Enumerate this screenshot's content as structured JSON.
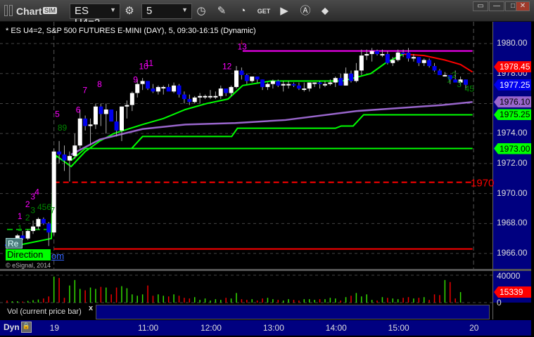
{
  "window": {
    "title": "Chart",
    "sim_badge": "SIM",
    "symbol": "ES U4=2",
    "interval": "5",
    "window_buttons": [
      "restore",
      "minimize",
      "maximize",
      "close"
    ],
    "toolbar_icons": [
      "settings-gear-icon",
      "clock-icon",
      "pencil-icon",
      "study-icon",
      "get-icon",
      "play-icon",
      "alert-icon",
      "link-icon"
    ]
  },
  "header": "* ES U4=2, S&P 500 FUTURES E-MINI (DAY), 5, 09:30-16:15 (Dynamic)",
  "overlay": {
    "direction_label": "Direction",
    "re_label": "Re",
    "om_label": "om",
    "copyright": "© eSignal, 2014"
  },
  "volume_panel": {
    "label": "Vol (current price bar)",
    "close": "x",
    "ticks": [
      "40000",
      "0"
    ],
    "current": "15339"
  },
  "footer": {
    "dyn": "Dyn"
  },
  "colors": {
    "up": "#ffffff",
    "down": "#0000ee",
    "ma": "#00ff00",
    "ma_down": "#ff0000",
    "vwap": "#9966cc",
    "target": "#ff00ff",
    "support": "#ff0000",
    "axis_bg": "#000080"
  },
  "chart_data": {
    "type": "candlestick",
    "title": "* ES U4=2, S&P 500 FUTURES E-MINI (DAY), 5, 09:30-16:15 (Dynamic)",
    "ylim": [
      1965.2,
      1980.8
    ],
    "y_ticks": [
      "1980.00",
      "1978.00",
      "1976.00",
      "1974.00",
      "1972.00",
      "1970.00",
      "1968.00",
      "1966.00"
    ],
    "x_ticks": [
      {
        "label": "19",
        "bar": 9
      },
      {
        "label": "11:00",
        "bar": 27
      },
      {
        "label": "12:00",
        "bar": 39
      },
      {
        "label": "13:00",
        "bar": 51
      },
      {
        "label": "14:00",
        "bar": 63
      },
      {
        "label": "15:00",
        "bar": 75
      },
      {
        "label": "20",
        "bar": 89.5
      }
    ],
    "price_tags": [
      {
        "label": "1978.45",
        "value": 1978.45,
        "color": "#ff0000",
        "text": "#ffffff"
      },
      {
        "label": "1977.25",
        "value": 1977.25,
        "color": "#0000ee",
        "text": "#ffffff"
      },
      {
        "label": "1976.10",
        "value": 1976.1,
        "color": "#9966cc",
        "text": "#000000"
      },
      {
        "label": "1975.25",
        "value": 1975.25,
        "color": "#00ff00",
        "text": "#000000"
      },
      {
        "label": "1973.00",
        "value": 1973.0,
        "color": "#00ff00",
        "text": "#000000"
      }
    ],
    "bars": [
      [
        1966.6,
        1966.8,
        1966.3,
        1966.5
      ],
      [
        1966.5,
        1967.0,
        1966.4,
        1966.9
      ],
      [
        1966.9,
        1967.3,
        1966.8,
        1967.2
      ],
      [
        1967.2,
        1967.5,
        1966.9,
        1967.0
      ],
      [
        1967.0,
        1967.6,
        1966.9,
        1967.5
      ],
      [
        1967.5,
        1968.2,
        1967.3,
        1967.8
      ],
      [
        1967.8,
        1968.4,
        1967.6,
        1968.3
      ],
      [
        1968.3,
        1968.4,
        1967.9,
        1968.0
      ],
      [
        1968.0,
        1968.1,
        1966.5,
        1967.4
      ],
      [
        1967.4,
        1973.0,
        1967.2,
        1972.8
      ],
      [
        1972.8,
        1973.5,
        1972.0,
        1972.6
      ],
      [
        1972.6,
        1973.2,
        1971.5,
        1972.2
      ],
      [
        1972.2,
        1972.8,
        1970.8,
        1972.5
      ],
      [
        1972.5,
        1974.0,
        1972.3,
        1973.2
      ],
      [
        1973.2,
        1975.6,
        1973.0,
        1975.0
      ],
      [
        1975.0,
        1975.2,
        1974.2,
        1974.5
      ],
      [
        1974.5,
        1975.0,
        1973.2,
        1974.6
      ],
      [
        1974.6,
        1976.0,
        1974.3,
        1975.8
      ],
      [
        1975.8,
        1976.0,
        1974.5,
        1975.3
      ],
      [
        1975.3,
        1976.0,
        1974.0,
        1975.6
      ],
      [
        1975.6,
        1975.6,
        1974.8,
        1974.8
      ],
      [
        1974.8,
        1975.5,
        1973.8,
        1974.2
      ],
      [
        1974.2,
        1975.8,
        1973.5,
        1975.8
      ],
      [
        1975.8,
        1976.2,
        1975.0,
        1975.9
      ],
      [
        1975.9,
        1976.8,
        1975.5,
        1976.7
      ],
      [
        1976.7,
        1977.6,
        1976.4,
        1977.3
      ],
      [
        1977.3,
        1977.7,
        1976.9,
        1977.5
      ],
      [
        1977.5,
        1977.5,
        1976.9,
        1977.0
      ],
      [
        1977.0,
        1977.3,
        1976.7,
        1976.8
      ],
      [
        1976.8,
        1977.2,
        1976.6,
        1977.1
      ],
      [
        1977.1,
        1977.2,
        1976.6,
        1977.1
      ],
      [
        1977.1,
        1977.3,
        1976.9,
        1976.8
      ],
      [
        1976.8,
        1977.4,
        1976.7,
        1977.2
      ],
      [
        1977.2,
        1977.3,
        1976.4,
        1976.6
      ],
      [
        1976.6,
        1976.8,
        1976.0,
        1976.3
      ],
      [
        1976.3,
        1976.6,
        1975.9,
        1976.1
      ],
      [
        1976.1,
        1976.5,
        1976.0,
        1976.4
      ],
      [
        1976.4,
        1976.7,
        1976.0,
        1976.5
      ],
      [
        1976.5,
        1976.6,
        1976.3,
        1976.5
      ],
      [
        1976.5,
        1976.9,
        1976.3,
        1976.5
      ],
      [
        1976.5,
        1976.8,
        1976.3,
        1976.5
      ],
      [
        1976.5,
        1977.2,
        1976.3,
        1977.0
      ],
      [
        1977.0,
        1977.0,
        1976.5,
        1976.7
      ],
      [
        1976.7,
        1977.2,
        1976.5,
        1977.1
      ],
      [
        1977.1,
        1978.5,
        1977.0,
        1978.2
      ],
      [
        1978.2,
        1978.4,
        1977.6,
        1977.9
      ],
      [
        1977.9,
        1978.0,
        1977.3,
        1977.5
      ],
      [
        1977.5,
        1977.8,
        1977.4,
        1977.8
      ],
      [
        1977.8,
        1977.8,
        1977.4,
        1977.6
      ],
      [
        1977.6,
        1977.6,
        1976.9,
        1977.1
      ],
      [
        1977.1,
        1977.4,
        1976.9,
        1977.3
      ],
      [
        1977.3,
        1977.6,
        1977.0,
        1977.5
      ],
      [
        1977.5,
        1977.6,
        1977.1,
        1977.2
      ],
      [
        1977.2,
        1977.5,
        1976.8,
        1977.3
      ],
      [
        1977.3,
        1977.5,
        1977.0,
        1977.3
      ],
      [
        1977.3,
        1977.4,
        1977.1,
        1977.2
      ],
      [
        1977.2,
        1977.4,
        1976.9,
        1977.0
      ],
      [
        1977.0,
        1977.4,
        1976.8,
        1977.0
      ],
      [
        1977.0,
        1977.4,
        1976.8,
        1977.4
      ],
      [
        1977.4,
        1977.4,
        1977.1,
        1977.4
      ],
      [
        1977.4,
        1977.5,
        1977.0,
        1977.3
      ],
      [
        1977.3,
        1977.5,
        1977.1,
        1977.3
      ],
      [
        1977.3,
        1977.6,
        1977.2,
        1977.4
      ],
      [
        1977.4,
        1977.8,
        1977.1,
        1977.7
      ],
      [
        1977.7,
        1978.0,
        1977.2,
        1977.2
      ],
      [
        1977.2,
        1978.4,
        1977.2,
        1978.0
      ],
      [
        1978.0,
        1978.2,
        1977.4,
        1977.5
      ],
      [
        1977.5,
        1978.7,
        1977.4,
        1978.2
      ],
      [
        1978.2,
        1979.6,
        1977.9,
        1979.2
      ],
      [
        1979.2,
        1979.6,
        1978.9,
        1979.3
      ],
      [
        1979.3,
        1979.7,
        1978.8,
        1979.5
      ],
      [
        1979.5,
        1979.6,
        1979.2,
        1979.3
      ],
      [
        1979.3,
        1979.6,
        1979.1,
        1979.3
      ],
      [
        1979.3,
        1979.5,
        1978.6,
        1978.7
      ],
      [
        1978.7,
        1979.1,
        1978.5,
        1978.9
      ],
      [
        1978.9,
        1979.6,
        1978.8,
        1979.4
      ],
      [
        1979.4,
        1979.6,
        1979.1,
        1979.3
      ],
      [
        1979.4,
        1979.7,
        1978.8,
        1979.0
      ],
      [
        1979.0,
        1979.3,
        1978.8,
        1979.1
      ],
      [
        1979.1,
        1979.1,
        1978.5,
        1978.7
      ],
      [
        1978.7,
        1979.0,
        1978.5,
        1978.9
      ],
      [
        1978.9,
        1979.0,
        1978.4,
        1978.5
      ],
      [
        1978.5,
        1978.7,
        1978.1,
        1978.2
      ],
      [
        1978.2,
        1978.3,
        1977.9,
        1977.9
      ],
      [
        1977.9,
        1978.1,
        1977.8,
        1977.9
      ],
      [
        1977.9,
        1977.9,
        1977.3,
        1977.6
      ],
      [
        1977.6,
        1978.2,
        1977.4,
        1977.4
      ],
      [
        1977.4,
        1977.8,
        1977.2,
        1977.6
      ],
      [
        1977.6,
        1977.6,
        1976.9,
        1977.25
      ]
    ],
    "volume": [
      3000,
      2000,
      2000,
      1500,
      2500,
      3500,
      4500,
      6000,
      9000,
      38000,
      36000,
      7000,
      25000,
      33000,
      20000,
      18000,
      22000,
      20000,
      23000,
      22000,
      12000,
      22000,
      24000,
      21000,
      12000,
      10000,
      12000,
      25000,
      10000,
      12000,
      10000,
      9000,
      12000,
      10000,
      7000,
      6000,
      8000,
      4000,
      6000,
      3000,
      5000,
      4000,
      7000,
      6000,
      14000,
      5000,
      4000,
      5000,
      3000,
      6000,
      7000,
      5000,
      4000,
      3000,
      5000,
      4000,
      3000,
      5000,
      5000,
      4000,
      5000,
      5000,
      7000,
      6000,
      3000,
      8000,
      10000,
      14000,
      9000,
      12000,
      4000,
      3000,
      8000,
      7000,
      6000,
      5000,
      7000,
      8000,
      6000,
      7000,
      8000,
      4000,
      12000,
      11000,
      33000,
      30000,
      6000,
      15339
    ],
    "vol_ylim": [
      0,
      40000
    ],
    "lines": [
      {
        "kind": "ma",
        "color": "#00ff00",
        "points": [
          [
            0,
            1966.4
          ],
          [
            8.5,
            1967.0
          ],
          [
            8.9,
            1972.0
          ],
          [
            9.5,
            1972.5
          ],
          [
            12.3,
            1971.8
          ],
          [
            15,
            1972.8
          ],
          [
            17.8,
            1973.5
          ],
          [
            20.5,
            1974.0
          ],
          [
            26,
            1974.6
          ],
          [
            30,
            1975.0
          ],
          [
            34.2,
            1975.6
          ],
          [
            38.3,
            1976.0
          ],
          [
            42.4,
            1976.3
          ],
          [
            45.2,
            1977.2
          ],
          [
            50.6,
            1977.5
          ],
          [
            64.3,
            1977.5
          ],
          [
            69.8,
            1978.0
          ],
          [
            72.6,
            1978.7
          ],
          [
            76,
            1979.3
          ]
        ]
      },
      {
        "kind": "ma-down",
        "color": "#ff0000",
        "points": [
          [
            76,
            1979.3
          ],
          [
            80,
            1979.2
          ],
          [
            84,
            1978.9
          ],
          [
            87,
            1978.6
          ],
          [
            89.3,
            1978.1
          ]
        ]
      },
      {
        "kind": "vwap",
        "color": "#9966cc",
        "points": [
          [
            12.3,
            1972.6
          ],
          [
            17.8,
            1973.6
          ],
          [
            26,
            1974.3
          ],
          [
            34.2,
            1974.6
          ],
          [
            43.8,
            1974.7
          ],
          [
            53.4,
            1974.9
          ],
          [
            67.1,
            1975.5
          ],
          [
            75.3,
            1975.7
          ],
          [
            83.5,
            1975.9
          ],
          [
            89.3,
            1976.1
          ]
        ]
      },
      {
        "kind": "step",
        "color": "#00ff00",
        "points": [
          [
            12.3,
            1972.2
          ],
          [
            15,
            1973.0
          ],
          [
            23.9,
            1973.0
          ],
          [
            26,
            1973.8
          ],
          [
            43.1,
            1973.8
          ],
          [
            44.2,
            1974.35
          ],
          [
            63,
            1974.35
          ],
          [
            64.1,
            1974.5
          ],
          [
            66.4,
            1974.5
          ],
          [
            68.4,
            1975.25
          ],
          [
            89.3,
            1975.25
          ]
        ]
      },
      {
        "kind": "level",
        "color": "#00ff00",
        "points": [
          [
            15,
            1973.0
          ],
          [
            89.3,
            1973.0
          ]
        ]
      },
      {
        "kind": "target",
        "color": "#ff00ff",
        "points": [
          [
            45.2,
            1979.5
          ],
          [
            89.3,
            1979.5
          ]
        ]
      },
      {
        "kind": "support-dashed",
        "color": "#ff0000",
        "label": "1970",
        "points": [
          [
            9,
            1970.75
          ],
          [
            89.3,
            1970.75
          ]
        ]
      },
      {
        "kind": "support",
        "color": "#ff0000",
        "points": [
          [
            9,
            1966.3
          ],
          [
            89.3,
            1966.3
          ]
        ]
      },
      {
        "kind": "dashed-green",
        "color": "#00aa00",
        "points": [
          [
            0,
            1967.6
          ],
          [
            9,
            1967.6
          ]
        ]
      }
    ],
    "annotations": [
      {
        "text": "1",
        "bar": 2,
        "price": 1968.3,
        "color": "#ff00ff"
      },
      {
        "text": "2",
        "bar": 3.5,
        "price": 1969.1,
        "color": "#ff00ff"
      },
      {
        "text": "3",
        "bar": 4.5,
        "price": 1969.6,
        "color": "#ff00ff"
      },
      {
        "text": "4",
        "bar": 5.3,
        "price": 1969.9,
        "color": "#ff00ff"
      },
      {
        "text": "5",
        "bar": 9.2,
        "price": 1975.1,
        "color": "#ff00ff"
      },
      {
        "text": "6",
        "bar": 13.2,
        "price": 1975.4,
        "color": "#ff00ff"
      },
      {
        "text": "7",
        "bar": 14.5,
        "price": 1976.7,
        "color": "#ff00ff"
      },
      {
        "text": "8",
        "bar": 17.3,
        "price": 1977.1,
        "color": "#ff00ff"
      },
      {
        "text": "9",
        "bar": 24.2,
        "price": 1977.4,
        "color": "#ff00ff"
      },
      {
        "text": "10",
        "bar": 25.3,
        "price": 1978.3,
        "color": "#ff00ff"
      },
      {
        "text": "11",
        "bar": 26.4,
        "price": 1978.5,
        "color": "#ff00ff"
      },
      {
        "text": "12",
        "bar": 41.3,
        "price": 1978.3,
        "color": "#ff00ff"
      },
      {
        "text": "13",
        "bar": 44.2,
        "price": 1979.6,
        "color": "#ff00ff"
      },
      {
        "text": "1",
        "bar": 2,
        "price": 1967.5,
        "color": "#008800"
      },
      {
        "text": "2",
        "bar": 3.5,
        "price": 1968.2,
        "color": "#008800"
      },
      {
        "text": "3",
        "bar": 4.5,
        "price": 1968.7,
        "color": "#008800"
      },
      {
        "text": "456",
        "bar": 5.8,
        "price": 1968.9,
        "color": "#008800"
      },
      {
        "text": "7",
        "bar": 8.3,
        "price": 1968.7,
        "color": "#008800"
      },
      {
        "text": "89",
        "bar": 9.7,
        "price": 1974.2,
        "color": "#008800"
      },
      {
        "text": "1",
        "bar": 84.3,
        "price": 1977.4,
        "color": "#008800"
      },
      {
        "text": "2",
        "bar": 85.3,
        "price": 1977.7,
        "color": "#008800"
      },
      {
        "text": "3",
        "bar": 86.3,
        "price": 1977.1,
        "color": "#008800"
      },
      {
        "text": "45",
        "bar": 87.8,
        "price": 1976.8,
        "color": "#008800"
      }
    ]
  }
}
